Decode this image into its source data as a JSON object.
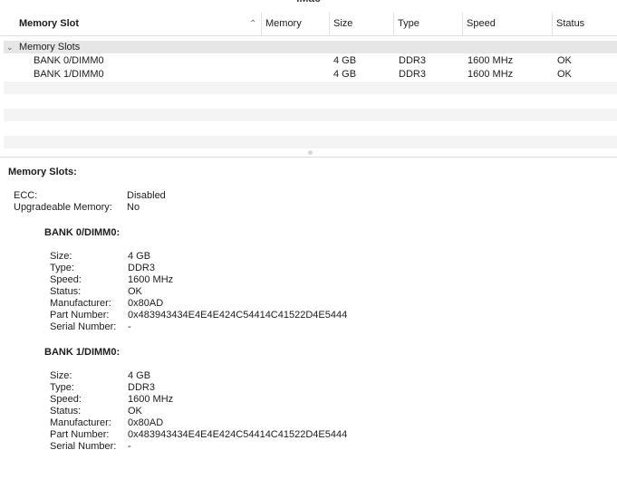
{
  "window": {
    "title_fragment": "iMac"
  },
  "table": {
    "columns": [
      {
        "label": "Memory Slot"
      },
      {
        "label": "Memory"
      },
      {
        "label": "Size"
      },
      {
        "label": "Type"
      },
      {
        "label": "Speed"
      },
      {
        "label": "Status"
      }
    ],
    "sort_icon": "chevron-up-icon",
    "group": {
      "label": "Memory Slots",
      "icon": "chevron-down-icon"
    },
    "rows": [
      {
        "slot": "BANK 0/DIMM0",
        "memory": "",
        "size": "4 GB",
        "type": "DDR3",
        "speed": "1600 MHz",
        "status": "OK"
      },
      {
        "slot": "BANK 1/DIMM0",
        "memory": "",
        "size": "4 GB",
        "type": "DDR3",
        "speed": "1600 MHz",
        "status": "OK"
      }
    ]
  },
  "detail": {
    "heading": "Memory Slots:",
    "ecc_label": "ECC:",
    "ecc_value": "Disabled",
    "upgradeable_label": "Upgradeable Memory:",
    "upgradeable_value": "No",
    "banks": [
      {
        "title": "BANK 0/DIMM0:",
        "fields": [
          {
            "label": "Size:",
            "value": "4 GB"
          },
          {
            "label": "Type:",
            "value": "DDR3"
          },
          {
            "label": "Speed:",
            "value": "1600 MHz"
          },
          {
            "label": "Status:",
            "value": "OK"
          },
          {
            "label": "Manufacturer:",
            "value": "0x80AD"
          },
          {
            "label": "Part Number:",
            "value": "0x483943434E4E4E424C54414C41522D4E5444"
          },
          {
            "label": "Serial Number:",
            "value": "-"
          }
        ]
      },
      {
        "title": "BANK 1/DIMM0:",
        "fields": [
          {
            "label": "Size:",
            "value": "4 GB"
          },
          {
            "label": "Type:",
            "value": "DDR3"
          },
          {
            "label": "Speed:",
            "value": "1600 MHz"
          },
          {
            "label": "Status:",
            "value": "OK"
          },
          {
            "label": "Manufacturer:",
            "value": "0x80AD"
          },
          {
            "label": "Part Number:",
            "value": "0x483943434E4E4E424C54414C41522D4E5444"
          },
          {
            "label": "Serial Number:",
            "value": "-"
          }
        ]
      }
    ]
  }
}
